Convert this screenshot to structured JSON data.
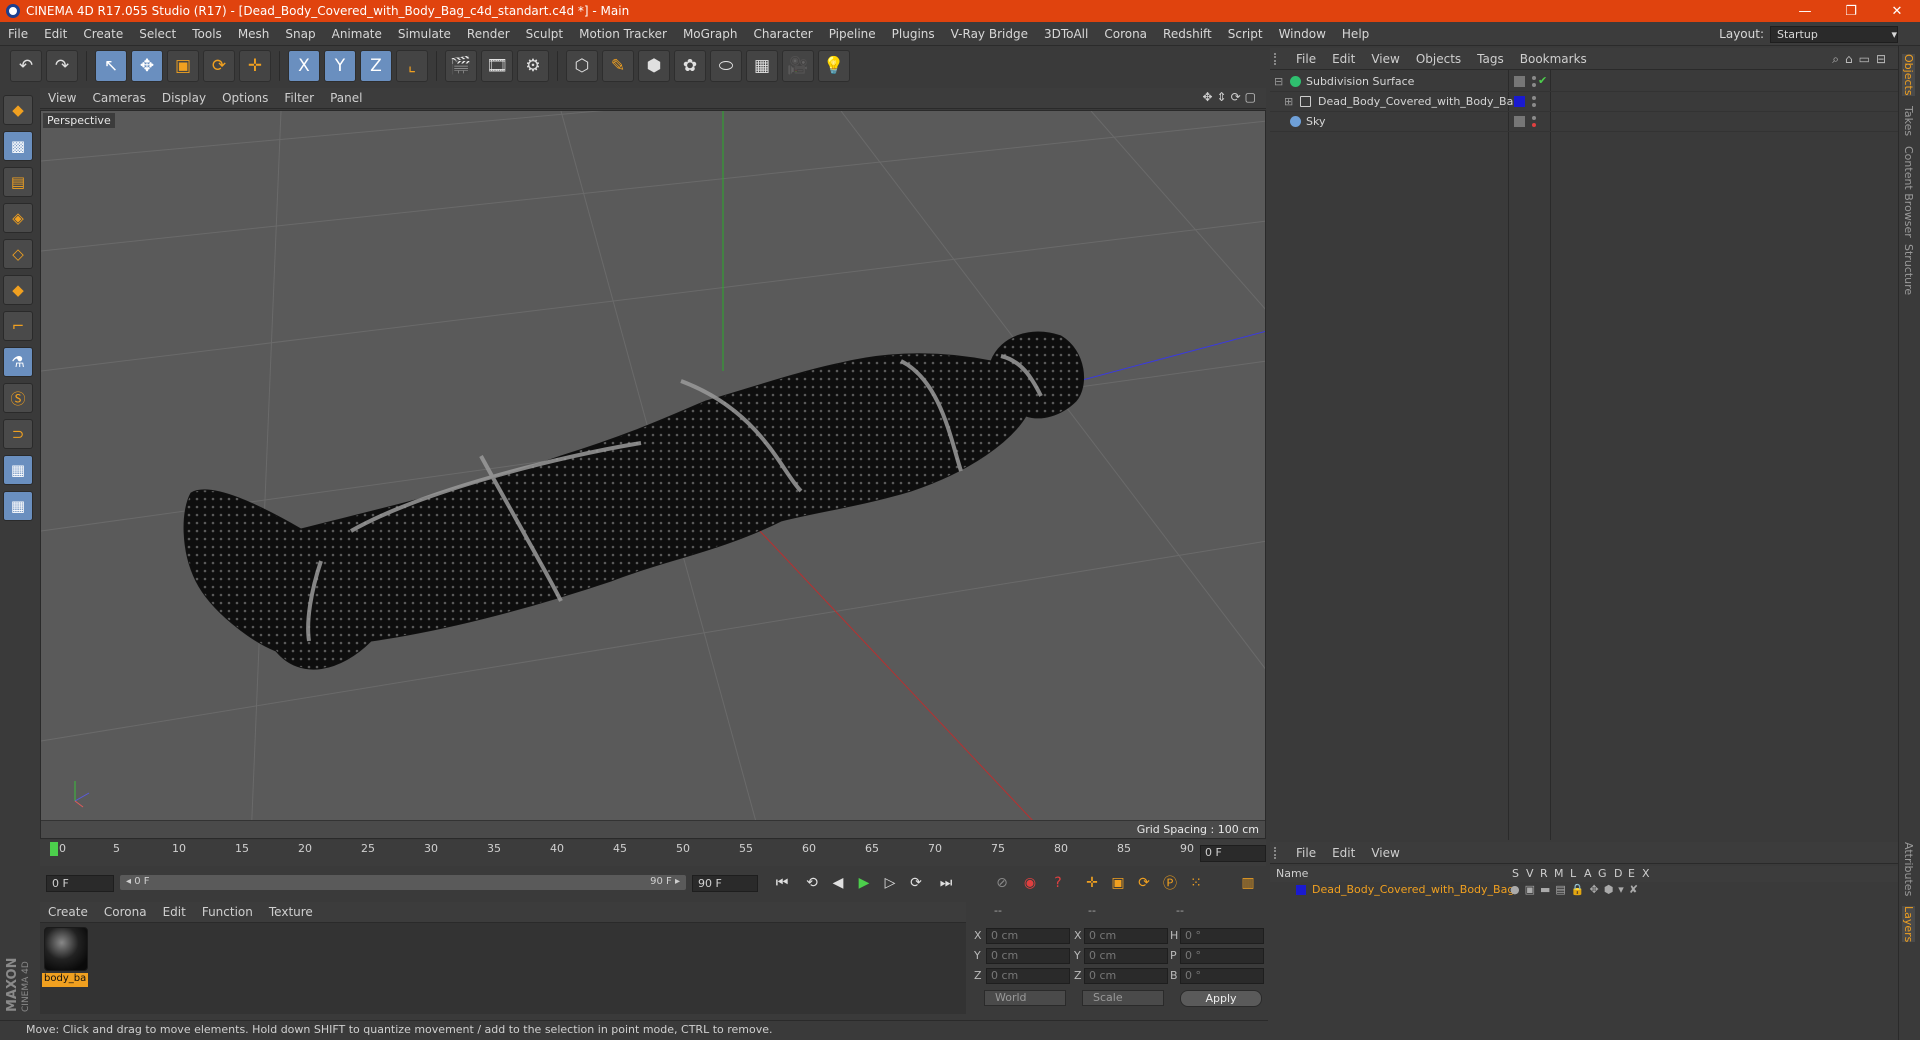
{
  "window": {
    "title": "CINEMA 4D R17.055 Studio (R17) - [Dead_Body_Covered_with_Body_Bag_c4d_standart.c4d *] - Main",
    "minimize": "—",
    "maximize": "❐",
    "close": "✕"
  },
  "menubar": {
    "items": [
      "File",
      "Edit",
      "Create",
      "Select",
      "Tools",
      "Mesh",
      "Snap",
      "Animate",
      "Simulate",
      "Render",
      "Sculpt",
      "Motion Tracker",
      "MoGraph",
      "Character",
      "Pipeline",
      "Plugins",
      "V-Ray Bridge",
      "3DToAll",
      "Corona",
      "Redshift",
      "Script",
      "Window",
      "Help"
    ],
    "layout_label": "Layout:",
    "layout_value": "Startup"
  },
  "toolbar": {
    "undo": "↶",
    "redo": "↷",
    "select": "↖",
    "move": "✥",
    "scale": "▣",
    "rotate": "⟳",
    "move2": "✛",
    "x": "X",
    "y": "Y",
    "z": "Z",
    "coord": "⌞",
    "render_view": "🎬",
    "render_pic": "🎞",
    "render_settings": "⚙",
    "cube": "⬡",
    "pen": "✎",
    "subdiv": "⬢",
    "mograph": "✿",
    "deformer": "⬭",
    "floor": "▦",
    "camera": "🎥",
    "light": "💡"
  },
  "lefttools": [
    "◆",
    "▩",
    "▤",
    "◈",
    "◇",
    "◆",
    "⌐",
    "⚗",
    "Ⓢ",
    "⊃",
    "▦",
    "▦"
  ],
  "viewport": {
    "menu": [
      "View",
      "Cameras",
      "Display",
      "Options",
      "Filter",
      "Panel"
    ],
    "label": "Perspective",
    "grid_spacing": "Grid Spacing : 100 cm",
    "nav_icons": "✥⇕⟳▢"
  },
  "timeline": {
    "ticks": [
      "0",
      "5",
      "10",
      "15",
      "20",
      "25",
      "30",
      "35",
      "40",
      "45",
      "50",
      "55",
      "60",
      "65",
      "70",
      "75",
      "80",
      "85",
      "90"
    ],
    "current_frame": "0 F"
  },
  "transport": {
    "start": "0 F",
    "range_start": "◂ 0 F",
    "range_end": "90 F ▸",
    "end": "90 F",
    "buttons": [
      "⏮",
      "⟲",
      "◀",
      "▶",
      "▷",
      "⟳",
      "⏭"
    ]
  },
  "material_manager": {
    "menu": [
      "Create",
      "Corona",
      "Edit",
      "Function",
      "Texture"
    ],
    "materials": [
      {
        "name": "body_ba"
      }
    ]
  },
  "coordinates": {
    "headers": [
      "--",
      "--",
      "--"
    ],
    "rows": [
      {
        "a1": "X",
        "v1": "0 cm",
        "a2": "X",
        "v2": "0 cm",
        "a3": "H",
        "v3": "0 °"
      },
      {
        "a1": "Y",
        "v1": "0 cm",
        "a2": "Y",
        "v2": "0 cm",
        "a3": "P",
        "v3": "0 °"
      },
      {
        "a1": "Z",
        "v1": "0 cm",
        "a2": "Z",
        "v2": "0 cm",
        "a3": "B",
        "v3": "0 °"
      }
    ],
    "mode1": "World",
    "mode2": "Scale",
    "apply": "Apply"
  },
  "statusbar": {
    "text": "Move: Click and drag to move elements. Hold down SHIFT to quantize movement / add to the selection in point mode, CTRL to remove."
  },
  "object_manager": {
    "menu": [
      "File",
      "Edit",
      "View",
      "Objects",
      "Tags",
      "Bookmarks"
    ],
    "icons": "⌕⌂▭⊟",
    "objects": [
      {
        "name": "Subdivision Surface",
        "color": "#2fbf6f"
      },
      {
        "name": "Dead_Body_Covered_with_Body_Bag",
        "color": "#1a1acf"
      },
      {
        "name": "Sky",
        "color": "#6fa0d8"
      }
    ],
    "check": "✔"
  },
  "layer_manager": {
    "menu": [
      "File",
      "Edit",
      "View"
    ],
    "columns": [
      "Name",
      "S",
      "V",
      "R",
      "M",
      "L",
      "A",
      "G",
      "D",
      "E",
      "X"
    ],
    "layers": [
      {
        "name": "Dead_Body_Covered_with_Body_Bag",
        "color": "#1a1acf"
      }
    ]
  },
  "right_tabs": [
    "Objects",
    "Takes",
    "Content Browser",
    "Structure",
    "Attributes",
    "Layers"
  ],
  "branding": {
    "maxon": "MAXON",
    "cinema": "CINEMA 4D"
  }
}
